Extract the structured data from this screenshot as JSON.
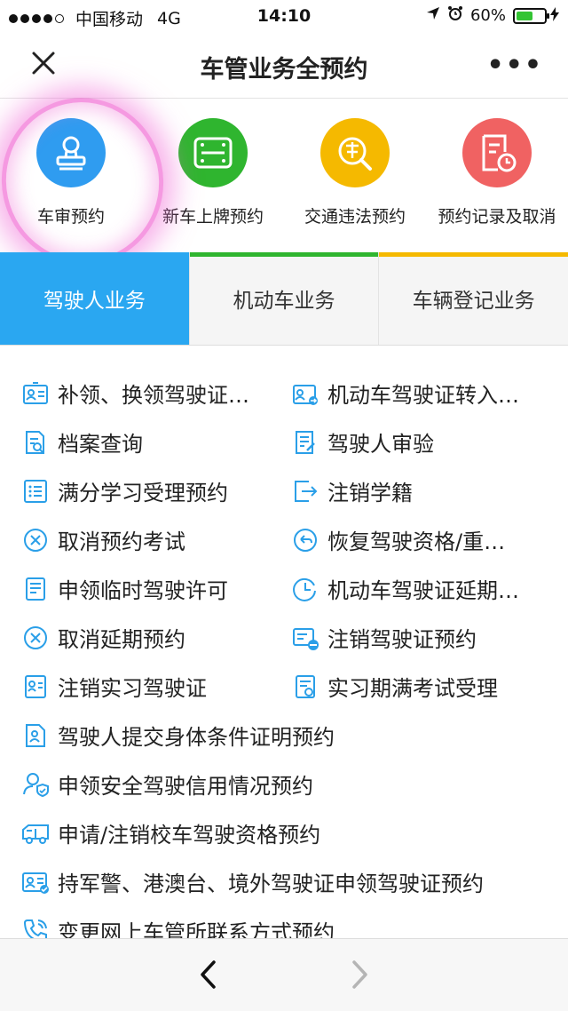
{
  "status_bar": {
    "carrier": "中国移动",
    "network": "4G",
    "time": "14:10",
    "battery": "60%",
    "battery_level": 0.6
  },
  "nav": {
    "title": "车管业务全预约",
    "more": "•••"
  },
  "quick_actions": [
    {
      "label": "车审预约",
      "color": "#2f9cf0",
      "icon": "stamp-icon"
    },
    {
      "label": "新车上牌预约",
      "color": "#2fb52f",
      "icon": "license-plate-icon"
    },
    {
      "label": "交通违法预约",
      "color": "#f5b900",
      "icon": "violation-search-icon"
    },
    {
      "label": "预约记录及取消",
      "color": "#f06262",
      "icon": "record-clock-icon"
    }
  ],
  "tabs": [
    {
      "label": "驾驶人业务",
      "active": true,
      "accent": "#2aa7f1"
    },
    {
      "label": "机动车业务",
      "active": false,
      "accent": "#2fb52f"
    },
    {
      "label": "车辆登记业务",
      "active": false,
      "accent": "#f5b900"
    }
  ],
  "services": {
    "r0": {
      "left": "补领、换领驾驶证…",
      "right": "机动车驾驶证转入…"
    },
    "r1": {
      "left": "档案查询",
      "right": "驾驶人审验"
    },
    "r2": {
      "left": "满分学习受理预约",
      "right": "注销学籍"
    },
    "r3": {
      "left": "取消预约考试",
      "right": "恢复驾驶资格/重…"
    },
    "r4": {
      "left": "申领临时驾驶许可",
      "right": "机动车驾驶证延期…"
    },
    "r5": {
      "left": "取消延期预约",
      "right": "注销驾驶证预约"
    },
    "r6": {
      "left": "注销实习驾驶证",
      "right": "实习期满考试受理"
    },
    "r7": {
      "full": "驾驶人提交身体条件证明预约"
    },
    "r8": {
      "full": "申领安全驾驶信用情况预约"
    },
    "r9": {
      "full": "申请/注销校车驾驶资格预约"
    },
    "r10": {
      "full": "持军警、港澳台、境外驾驶证申领驾驶证预约"
    },
    "r11": {
      "full": "变更网上车管所联系方式预约"
    }
  },
  "colors": {
    "icon_blue": "#2a9fe8",
    "highlight": "#ec46c8"
  }
}
